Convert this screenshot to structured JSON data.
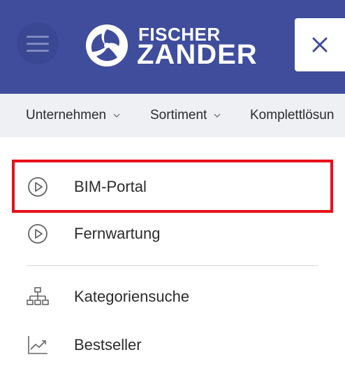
{
  "header": {
    "brand_top": "FISCHER",
    "brand_bottom": "ZANDER",
    "menu_icon": "hamburger-icon",
    "close_icon": "close-icon"
  },
  "nav": {
    "items": [
      {
        "label": "Unternehmen"
      },
      {
        "label": "Sortiment"
      },
      {
        "label": "Komplettlösun"
      }
    ]
  },
  "menu": {
    "items": [
      {
        "label": "BIM-Portal",
        "icon": "play-circle-icon"
      },
      {
        "label": "Fernwartung",
        "icon": "play-circle-icon"
      },
      {
        "label": "Kategoriensuche",
        "icon": "sitemap-icon"
      },
      {
        "label": "Bestseller",
        "icon": "trending-chart-icon"
      }
    ]
  },
  "colors": {
    "header_bg": "#3f4d9c",
    "nav_bg": "#eef0f4",
    "highlight": "#e8101a"
  }
}
